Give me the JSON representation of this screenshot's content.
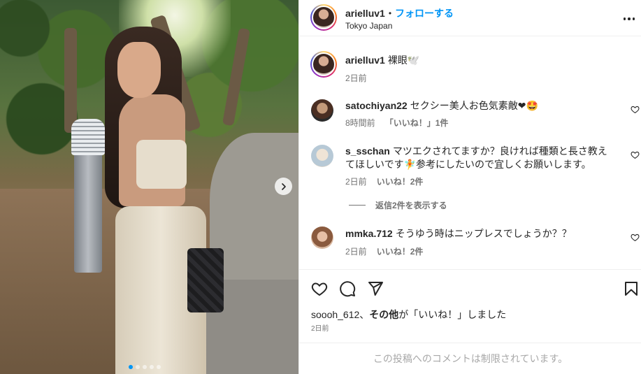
{
  "post": {
    "author": "arielluv1",
    "follow_label": "フォローする",
    "separator": "•",
    "location": "Tokyo Japan",
    "caption": "裸眼🕊️",
    "caption_time": "2日前"
  },
  "carousel": {
    "slide_count": 5,
    "active_index": 0,
    "next_icon": "chevron-right-icon"
  },
  "comments": [
    {
      "user": "satochiyan22",
      "text": "セクシー美人お色気素敵❤🤩",
      "time": "8時間前",
      "likes": "「いいね！」1件",
      "replies": ""
    },
    {
      "user": "s_sschan",
      "text": "マツエクされてますか？良ければ種類と長さ教えてほしいです🧚参考にしたいので宜しくお願いします。",
      "time": "2日前",
      "likes": "いいね！2件",
      "replies": "返信2件を表示する"
    },
    {
      "user": "mmka.712",
      "text": "そうゆう時はニップレスでしょうか？？",
      "time": "2日前",
      "likes": "いいね！2件",
      "replies": ""
    }
  ],
  "likes_line": {
    "user": "soooh_612",
    "sep": "、",
    "others": "その他",
    "suffix": "が「いいね！」しました"
  },
  "post_date": "2日前",
  "restricted_notice": "この投稿へのコメントは制限されています。",
  "icons": {
    "more": "more-horizontal-icon",
    "like": "heart-icon",
    "comment": "comment-icon",
    "share": "share-icon",
    "save": "bookmark-icon"
  },
  "colors": {
    "link_blue": "#0095f6",
    "text": "#262626",
    "muted": "#737373"
  }
}
